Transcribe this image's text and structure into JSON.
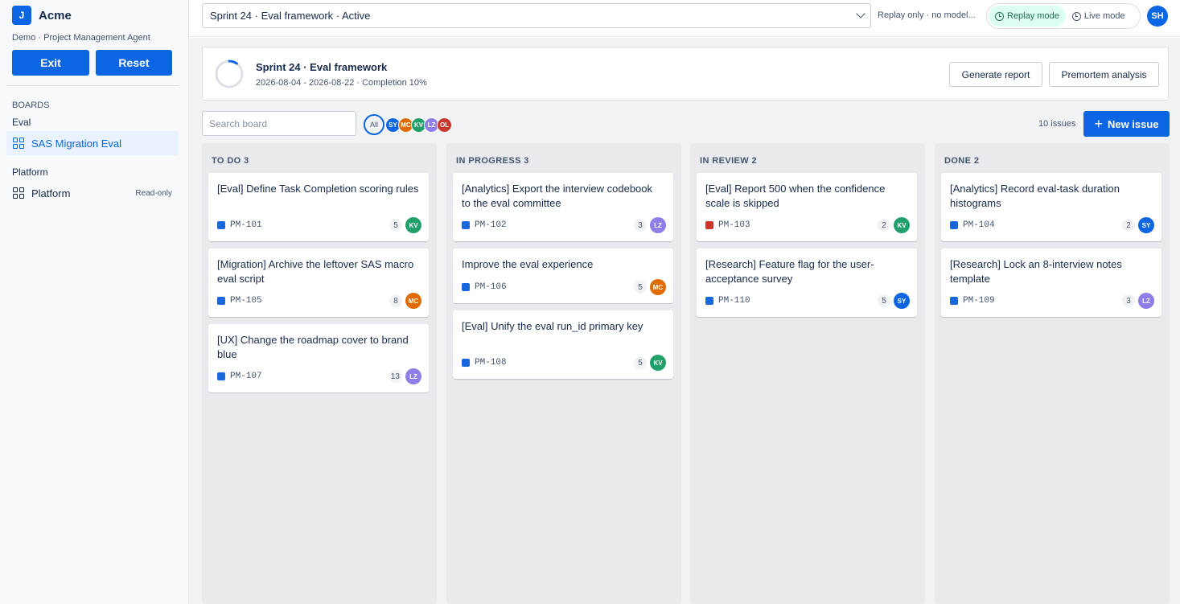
{
  "app": {
    "logo_letter": "J",
    "name": "Acme",
    "subtitle": "Demo · Project Management Agent",
    "exit_label": "Exit",
    "reset_label": "Reset"
  },
  "sidebar": {
    "boards_label": "BOARDS",
    "eval_group": "Eval",
    "eval_board": "SAS Migration Eval",
    "platform_group": "Platform",
    "platform_board": "Platform",
    "platform_badge": "Read-only"
  },
  "topbar": {
    "sprint_select": "Sprint 24 · Eval framework · Active",
    "replay_info": "Replay only · no model...",
    "replay_mode": "Replay mode",
    "live_mode": "Live mode",
    "user_initials": "SH"
  },
  "sprint": {
    "title": "Sprint 24 · Eval framework",
    "meta": "2026-08-04 - 2026-08-22 · Completion 10%",
    "completion": 0.1,
    "generate_report": "Generate report",
    "premortem": "Premortem analysis"
  },
  "toolbar": {
    "search_placeholder": "Search board",
    "filter_all": "All",
    "issues_count": "10 issues",
    "new_issue": "New issue"
  },
  "people": {
    "SY": "#0c66e4",
    "MC": "#e06c00",
    "KV": "#22a06b",
    "LZ": "#8f7ee7",
    "OL": "#c9372c"
  },
  "filter_avatars": [
    "SY",
    "MC",
    "KV",
    "LZ",
    "OL"
  ],
  "type_colors": {
    "task": "#1868db",
    "bug": "#c9372c"
  },
  "columns": [
    {
      "title": "TO DO 3",
      "cards": [
        {
          "title": "[Eval] Define Task Completion scoring rules",
          "key": "PM-101",
          "type": "task",
          "points": "5",
          "assignee": "KV"
        },
        {
          "title": "[Migration] Archive the leftover SAS macro eval script",
          "key": "PM-105",
          "type": "task",
          "points": "8",
          "assignee": "MC"
        },
        {
          "title": "[UX] Change the roadmap cover to brand blue",
          "key": "PM-107",
          "type": "task",
          "points": "13",
          "assignee": "LZ"
        }
      ]
    },
    {
      "title": "IN PROGRESS 3",
      "cards": [
        {
          "title": "[Analytics] Export the interview codebook to the eval committee",
          "key": "PM-102",
          "type": "task",
          "points": "3",
          "assignee": "LZ"
        },
        {
          "title": "Improve the eval experience",
          "key": "PM-106",
          "type": "task",
          "points": "5",
          "assignee": "MC"
        },
        {
          "title": "[Eval] Unify the eval run_id primary key",
          "key": "PM-108",
          "type": "task",
          "points": "5",
          "assignee": "KV"
        }
      ]
    },
    {
      "title": "IN REVIEW 2",
      "cards": [
        {
          "title": "[Eval] Report 500 when the confidence scale is skipped",
          "key": "PM-103",
          "type": "bug",
          "points": "2",
          "assignee": "KV"
        },
        {
          "title": "[Research] Feature flag for the user-acceptance survey",
          "key": "PM-110",
          "type": "task",
          "points": "5",
          "assignee": "SY"
        }
      ]
    },
    {
      "title": "DONE 2",
      "cards": [
        {
          "title": "[Analytics] Record eval-task duration histograms",
          "key": "PM-104",
          "type": "task",
          "points": "2",
          "assignee": "SY"
        },
        {
          "title": "[Research] Lock an 8-interview notes template",
          "key": "PM-109",
          "type": "task",
          "points": "3",
          "assignee": "LZ"
        }
      ]
    }
  ]
}
